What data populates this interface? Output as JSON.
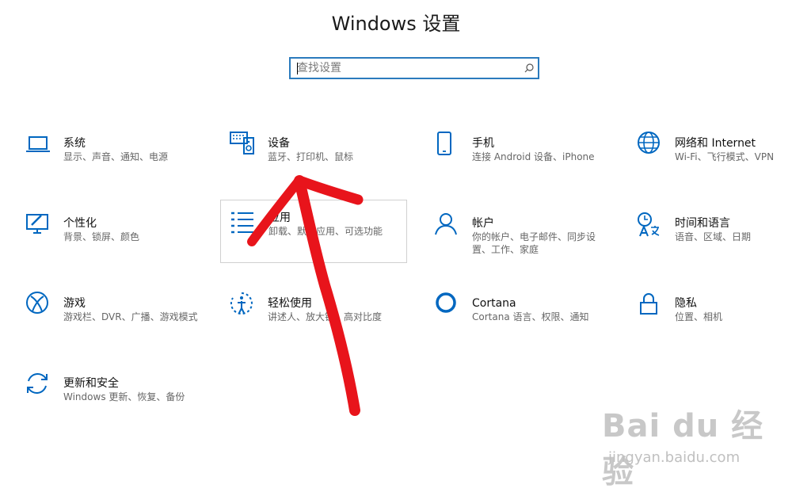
{
  "header": {
    "title": "Windows 设置"
  },
  "search": {
    "placeholder": "查找设置"
  },
  "tiles": [
    {
      "name": "系统",
      "desc": "显示、声音、通知、电源",
      "icon": "laptop-icon"
    },
    {
      "name": "设备",
      "desc": "蓝牙、打印机、鼠标",
      "icon": "keyboard-speaker-icon"
    },
    {
      "name": "手机",
      "desc": "连接 Android 设备、iPhone",
      "icon": "phone-icon"
    },
    {
      "name": "网络和 Internet",
      "desc": "Wi-Fi、飞行模式、VPN",
      "icon": "globe-icon"
    },
    {
      "name": "个性化",
      "desc": "背景、锁屏、颜色",
      "icon": "paint-monitor-icon"
    },
    {
      "name": "应用",
      "desc": "卸载、默认应用、可选功能",
      "icon": "apps-list-icon"
    },
    {
      "name": "帐户",
      "desc": "你的帐户、电子邮件、同步设置、工作、家庭",
      "icon": "person-icon"
    },
    {
      "name": "时间和语言",
      "desc": "语音、区域、日期",
      "icon": "time-language-icon"
    },
    {
      "name": "游戏",
      "desc": "游戏栏、DVR、广播、游戏模式",
      "icon": "xbox-icon"
    },
    {
      "name": "轻松使用",
      "desc": "讲述人、放大镜、高对比度",
      "icon": "ease-of-access-icon"
    },
    {
      "name": "Cortana",
      "desc": "Cortana 语言、权限、通知",
      "icon": "cortana-icon"
    },
    {
      "name": "隐私",
      "desc": "位置、相机",
      "icon": "lock-icon"
    },
    {
      "name": "更新和安全",
      "desc": "Windows 更新、恢复、备份",
      "icon": "sync-icon"
    }
  ],
  "watermark": {
    "logo": "Bai du 经验",
    "url": "jingyan.baidu.com"
  },
  "colors": {
    "accent": "#0067c0",
    "arrow": "#e8141b",
    "search_border": "#2b7bbd"
  }
}
